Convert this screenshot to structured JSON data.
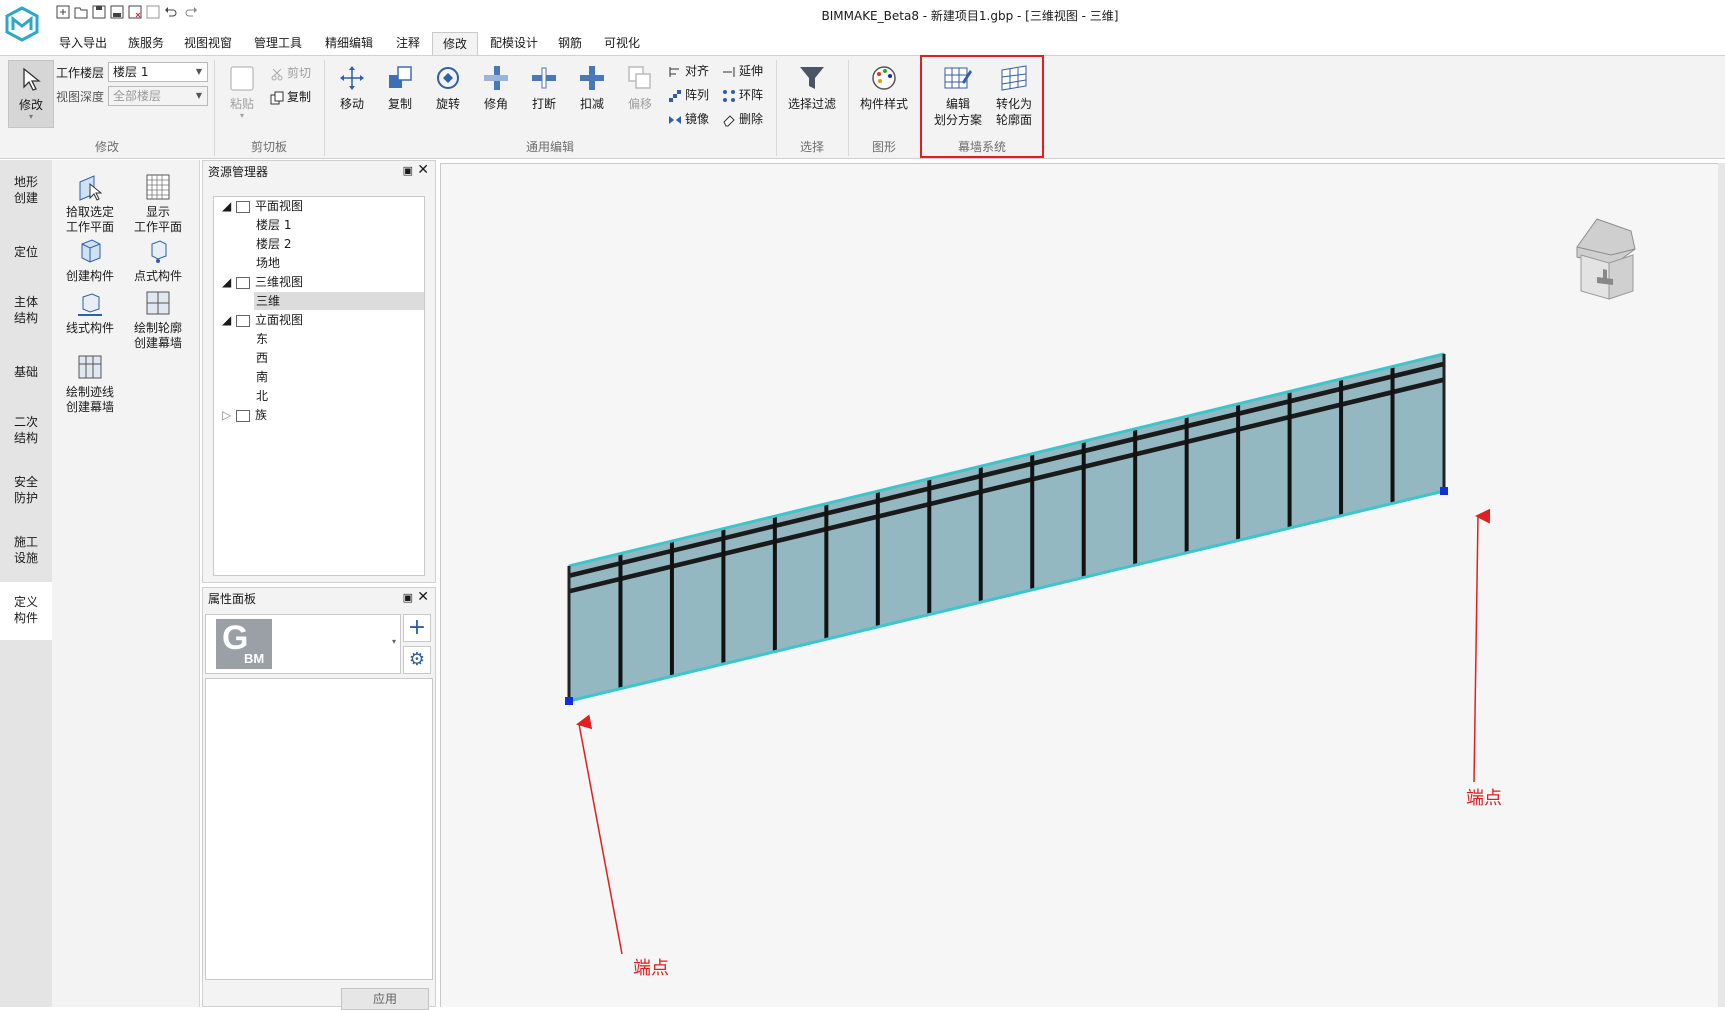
{
  "window": {
    "title": "BIMMAKE_Beta8 - 新建项目1.gbp - [三维视图 - 三维]"
  },
  "quick_access": [
    "new-icon",
    "open-icon",
    "save-icon",
    "save-as-icon",
    "close-file-icon",
    "blank-icon",
    "undo-icon",
    "redo-icon"
  ],
  "menu": {
    "tabs": [
      "导入导出",
      "族服务",
      "视图视窗",
      "管理工具",
      "精细编辑",
      "注释",
      "修改",
      "配模设计",
      "钢筋",
      "可视化"
    ],
    "active": "修改"
  },
  "ribbon": {
    "modify": {
      "label": "修改",
      "button": "修改",
      "work_level_label": "工作楼层",
      "work_level_value": "楼层 1",
      "view_depth_label": "视图深度",
      "view_depth_value": "全部楼层"
    },
    "clipboard": {
      "label": "剪切板",
      "paste": "粘贴",
      "cut": "剪切",
      "copy": "复制"
    },
    "edit": {
      "label": "通用编辑",
      "move": "移动",
      "copy": "复制",
      "rotate": "旋转",
      "trim": "修角",
      "break": "打断",
      "deduct": "扣减",
      "offset": "偏移",
      "align": "对齐",
      "array": "阵列",
      "mirror": "镜像",
      "extend": "延伸",
      "ring_array": "环阵",
      "delete": "删除"
    },
    "select": {
      "label": "选择",
      "filter": "选择过滤"
    },
    "graphics": {
      "label": "图形",
      "style": "构件样式"
    },
    "curtain": {
      "label": "幕墙系统",
      "edit_line1": "编辑",
      "edit_line2": "划分方案",
      "convert_line1": "转化为",
      "convert_line2": "轮廓面",
      "highlight_color": "#e02020"
    }
  },
  "categories": [
    "地形\n创建",
    "定位",
    "主体\n结构",
    "基础",
    "二次\n结构",
    "安全\n防护",
    "施工\n设施",
    "定义\n构件"
  ],
  "active_category": "定义\n构件",
  "tools": {
    "pick_plane": "拾取选定\n工作平面",
    "show_plane": "显示\n工作平面",
    "create_member": "创建构件",
    "point_member": "点式构件",
    "line_member": "线式构件",
    "draw_outline": "绘制轮廓\n创建幕墙",
    "draw_trace": "绘制迹线\n创建幕墙"
  },
  "resource_manager": {
    "title": "资源管理器",
    "plan_view": "平面视图",
    "level1": "楼层 1",
    "level2": "楼层 2",
    "site": "场地",
    "view_3d": "三维视图",
    "view_3d_item": "三维",
    "elevation": "立面视图",
    "east": "东",
    "west": "西",
    "south": "南",
    "north": "北",
    "family": "族"
  },
  "properties": {
    "title": "属性面板",
    "logo_letter": "G",
    "logo_sub": "BM",
    "apply": "应用"
  },
  "viewport": {
    "annotation_left": "端点",
    "annotation_right": "端点",
    "annotation_color": "#e02020",
    "glass_color": "#94b8c2",
    "edge_color": "#3cc6cc",
    "endpoint_color": "#1030e0"
  }
}
